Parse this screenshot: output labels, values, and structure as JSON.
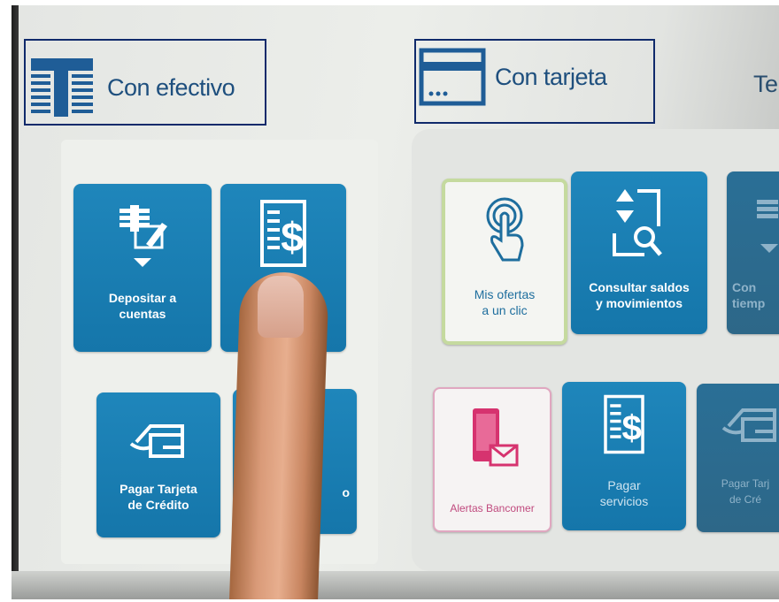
{
  "tabs": {
    "cash": {
      "label": "Con efectivo",
      "icon": "cash-stack-icon"
    },
    "card": {
      "label": "Con tarjeta",
      "icon": "credit-card-icon"
    },
    "third": {
      "label": "Te"
    }
  },
  "cash_tiles": [
    {
      "label": "Depositar a\ncuentas",
      "icon": "deposit-icon"
    },
    {
      "label": "",
      "icon": "bill-dollar-icon"
    },
    {
      "label": "Pagar Tarjeta\nde Crédito",
      "icon": "card-payment-icon"
    },
    {
      "label": "o",
      "icon": ""
    }
  ],
  "card_tiles": [
    {
      "label": "Mis ofertas\na un clic",
      "icon": "touch-hand-icon"
    },
    {
      "label": "Consultar saldos\ny movimientos",
      "icon": "search-balance-icon"
    },
    {
      "label": "Con\ntiemp",
      "icon": "phone-topup-icon"
    },
    {
      "label": "Alertas Bancomer",
      "icon": "mobile-mail-icon"
    },
    {
      "label": "Pagar\nservicios",
      "icon": "bill-dollar-icon"
    },
    {
      "label": "Pagar Tarj\nde Cré",
      "icon": "card-payment-icon"
    }
  ],
  "colors": {
    "tile_blue": "#1a7fb6",
    "header_text": "#1e4f7e",
    "outline_box": "#102a6b",
    "green_outline": "#c5da9f",
    "pink_outline": "#e0a7c0"
  }
}
